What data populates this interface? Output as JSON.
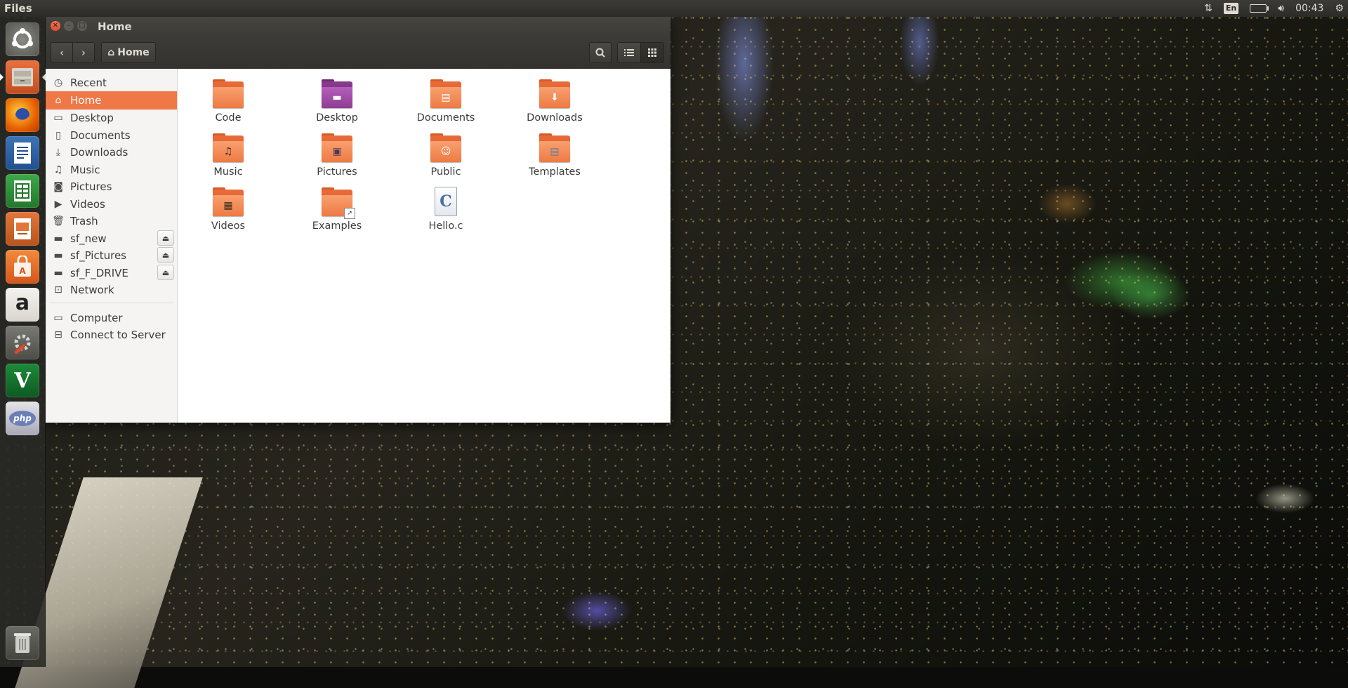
{
  "top_panel": {
    "app_name": "Files",
    "clock": "00:43",
    "lang": "En",
    "icons": [
      "network-icon",
      "keyboard-lang-icon",
      "battery-icon",
      "volume-icon",
      "settings-gear-icon"
    ]
  },
  "launcher": {
    "items": [
      {
        "name": "ubuntu-dash",
        "icon": "ubuntu-logo-icon"
      },
      {
        "name": "files",
        "icon": "file-cabinet-icon",
        "active": true
      },
      {
        "name": "firefox",
        "icon": "firefox-icon"
      },
      {
        "name": "libreoffice-writer",
        "icon": "writer-icon"
      },
      {
        "name": "libreoffice-calc",
        "icon": "calc-icon"
      },
      {
        "name": "libreoffice-impress",
        "icon": "impress-icon"
      },
      {
        "name": "ubuntu-software",
        "icon": "shopping-bag-icon"
      },
      {
        "name": "amazon",
        "icon": "amazon-icon",
        "glyph": "a"
      },
      {
        "name": "system-settings",
        "icon": "tools-icon"
      },
      {
        "name": "vim",
        "icon": "vim-icon",
        "glyph": "V"
      },
      {
        "name": "php",
        "icon": "php-icon",
        "glyph": "php"
      },
      {
        "name": "trash",
        "icon": "trash-icon"
      }
    ]
  },
  "window": {
    "title": "Home",
    "path_button": "Home"
  },
  "sidebar": {
    "items": [
      {
        "label": "Recent",
        "icon": "clock-icon"
      },
      {
        "label": "Home",
        "icon": "home-icon",
        "selected": true
      },
      {
        "label": "Desktop",
        "icon": "folder-icon"
      },
      {
        "label": "Documents",
        "icon": "document-icon"
      },
      {
        "label": "Downloads",
        "icon": "download-icon"
      },
      {
        "label": "Music",
        "icon": "music-note-icon"
      },
      {
        "label": "Pictures",
        "icon": "camera-icon"
      },
      {
        "label": "Videos",
        "icon": "film-icon"
      },
      {
        "label": "Trash",
        "icon": "trash-icon"
      },
      {
        "label": "sf_new",
        "icon": "drive-icon",
        "eject": true
      },
      {
        "label": "sf_Pictures",
        "icon": "drive-icon",
        "eject": true
      },
      {
        "label": "sf_F_DRIVE",
        "icon": "drive-icon",
        "eject": true
      },
      {
        "label": "Network",
        "icon": "network-icon"
      },
      {
        "label": "Computer",
        "icon": "computer-icon"
      },
      {
        "label": "Connect to Server",
        "icon": "server-icon"
      }
    ]
  },
  "content": {
    "items": [
      {
        "label": "Code",
        "type": "folder"
      },
      {
        "label": "Desktop",
        "type": "folder-desktop"
      },
      {
        "label": "Documents",
        "type": "folder-documents"
      },
      {
        "label": "Downloads",
        "type": "folder-downloads"
      },
      {
        "label": "Music",
        "type": "folder-music"
      },
      {
        "label": "Pictures",
        "type": "folder-pictures"
      },
      {
        "label": "Public",
        "type": "folder-public"
      },
      {
        "label": "Templates",
        "type": "folder-templates"
      },
      {
        "label": "Videos",
        "type": "folder-videos"
      },
      {
        "label": "Examples",
        "type": "folder-link"
      },
      {
        "label": "Hello.c",
        "type": "c-source-file"
      }
    ]
  },
  "colors": {
    "accent": "#f07746",
    "panel": "#3c3b37",
    "folder": "#ee7a43"
  }
}
